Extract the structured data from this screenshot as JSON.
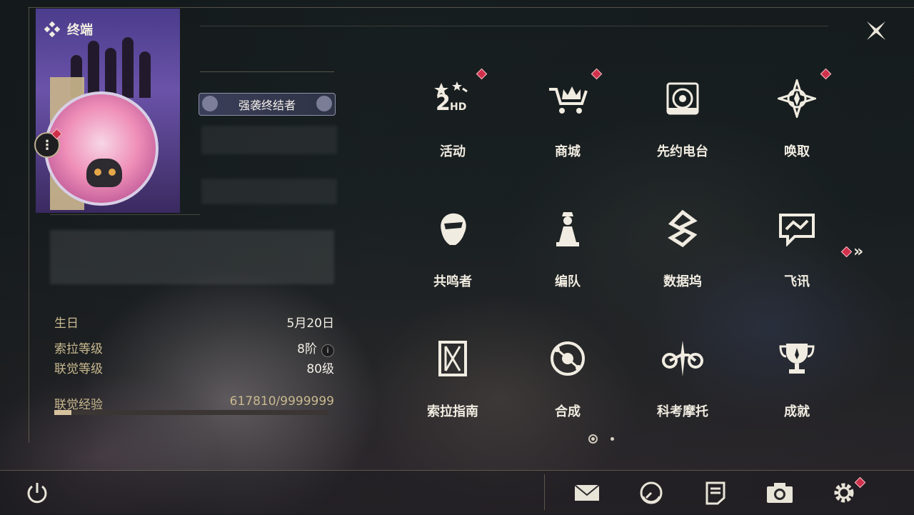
{
  "header": {
    "title": "终端"
  },
  "profile": {
    "title_badge": "强袭终结者",
    "rows": [
      {
        "key": "生日",
        "value": "5月20日"
      },
      {
        "key": "索拉等级",
        "value": "8阶"
      },
      {
        "key": "联觉等级",
        "value": "80级"
      }
    ],
    "xp": {
      "label": "联觉经验",
      "value": "617810/9999999",
      "fraction": 0.0618
    }
  },
  "grid": [
    {
      "label": "活动",
      "icon": "event-2hd-icon",
      "badge": true
    },
    {
      "label": "商城",
      "icon": "crown-cart-icon",
      "badge": true
    },
    {
      "label": "先约电台",
      "icon": "radio-speaker-icon",
      "badge": false
    },
    {
      "label": "唤取",
      "icon": "compass-star-icon",
      "badge": true
    },
    {
      "label": "共鸣者",
      "icon": "character-head-icon",
      "badge": false
    },
    {
      "label": "编队",
      "icon": "chess-team-icon",
      "badge": false
    },
    {
      "label": "数据坞",
      "icon": "data-dock-icon",
      "badge": false
    },
    {
      "label": "飞讯",
      "icon": "chat-bubble-icon",
      "badge": false
    },
    {
      "label": "索拉指南",
      "icon": "guide-book-icon",
      "badge": false
    },
    {
      "label": "合成",
      "icon": "synthesis-orbit-icon",
      "badge": false
    },
    {
      "label": "科考摩托",
      "icon": "motorcycle-icon",
      "badge": false
    },
    {
      "label": "成就",
      "icon": "trophy-icon",
      "badge": false
    }
  ],
  "pagination": {
    "current": 1,
    "total": 2
  },
  "colors": {
    "accent": "#d0304a",
    "gold": "#c9b98f",
    "text": "#f1ece1"
  }
}
